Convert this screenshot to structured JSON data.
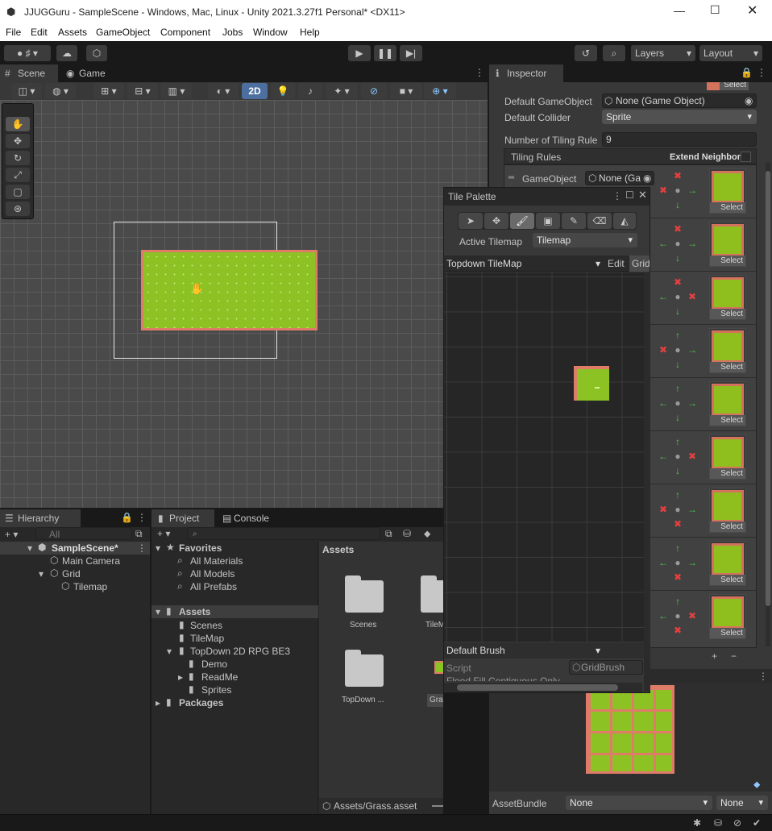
{
  "window": {
    "title": "JJUGGuru - SampleScene - Windows, Mac, Linux - Unity 2021.3.27f1 Personal* <DX11>"
  },
  "menu": [
    "File",
    "Edit",
    "Assets",
    "GameObject",
    "Component",
    "Jobs",
    "Window",
    "Help"
  ],
  "toolbar": {
    "layers": "Layers",
    "layout": "Layout"
  },
  "scene": {
    "tab_scene": "Scene",
    "tab_game": "Game",
    "mode_2d": "2D"
  },
  "inspector": {
    "tab": "Inspector",
    "top_select": "Select",
    "default_gameobject_label": "Default GameObject",
    "default_gameobject_value": "None (Game Object)",
    "default_collider_label": "Default Collider",
    "default_collider_value": "Sprite",
    "num_rules_label": "Number of Tiling Rule",
    "num_rules_value": "9",
    "tiling_rules": "Tiling Rules",
    "extend_neighbor": "Extend Neighbor",
    "gameobject_label": "GameObject",
    "gameobject_value": "None (Ga",
    "select_label": "Select",
    "assetbundle_label": "AssetBundle",
    "assetbundle_value": "None",
    "assetbundle_variant": "None",
    "plus": "+",
    "minus": "−"
  },
  "tile_palette": {
    "title": "Tile Palette",
    "active_tilemap_label": "Active Tilemap",
    "active_tilemap_value": "Tilemap",
    "palette": "Topdown TileMap",
    "edit": "Edit",
    "grid": "Grid",
    "brush": "Default Brush",
    "script_label": "Script",
    "script_value": "GridBrush",
    "flood": "Flood Fill Contiguous Only"
  },
  "hierarchy": {
    "tab": "Hierarchy",
    "search_placeholder": "All",
    "items": [
      {
        "label": "SampleScene*"
      },
      {
        "label": "Main Camera"
      },
      {
        "label": "Grid"
      },
      {
        "label": "Tilemap"
      }
    ]
  },
  "project": {
    "tab_project": "Project",
    "tab_console": "Console",
    "favorites": "Favorites",
    "fav_items": [
      "All Materials",
      "All Models",
      "All Prefabs"
    ],
    "assets": "Assets",
    "asset_tree": [
      "Scenes",
      "TileMap",
      "TopDown 2D RPG BE3",
      "Demo",
      "ReadMe",
      "Sprites"
    ],
    "packages": "Packages",
    "assets_header": "Assets",
    "grid_items": [
      "Scenes",
      "TileM",
      "TopDown ...",
      "Grass"
    ],
    "footer_path": "Assets/Grass.asset"
  }
}
